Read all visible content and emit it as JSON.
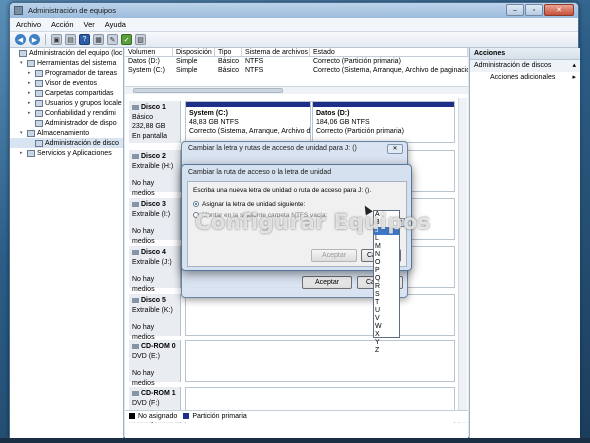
{
  "window": {
    "title": "Administración de equipos"
  },
  "menu": [
    "Archivo",
    "Acción",
    "Ver",
    "Ayuda"
  ],
  "tree": [
    {
      "label": "Administración del equipo (loc",
      "indent": 0,
      "expand": ""
    },
    {
      "label": "Herramientas del sistema",
      "indent": 1,
      "expand": "▾"
    },
    {
      "label": "Programador de tareas",
      "indent": 2,
      "expand": "▸"
    },
    {
      "label": "Visor de eventos",
      "indent": 2,
      "expand": "▸"
    },
    {
      "label": "Carpetas compartidas",
      "indent": 2,
      "expand": "▸"
    },
    {
      "label": "Usuarios y grupos locale",
      "indent": 2,
      "expand": "▸"
    },
    {
      "label": "Confiabilidad y rendimi",
      "indent": 2,
      "expand": "▸"
    },
    {
      "label": "Administrador de dispo",
      "indent": 2,
      "expand": ""
    },
    {
      "label": "Almacenamiento",
      "indent": 1,
      "expand": "▾"
    },
    {
      "label": "Administración de disco",
      "indent": 2,
      "expand": ""
    },
    {
      "label": "Servicios y Aplicaciones",
      "indent": 1,
      "expand": "▸"
    }
  ],
  "volume_columns": [
    "Volumen",
    "Disposición",
    "Tipo",
    "Sistema de archivos",
    "Estado"
  ],
  "volumes": [
    {
      "vol": "Datos (D:)",
      "disp": "Simple",
      "tipo": "Básico",
      "fs": "NTFS",
      "estado": "Correcto (Partición primaria)"
    },
    {
      "vol": "System (C:)",
      "disp": "Simple",
      "tipo": "Básico",
      "fs": "NTFS",
      "estado": "Correcto (Sistema, Arranque, Archivo de paginación"
    }
  ],
  "disks": [
    {
      "name": "Disco 1",
      "l1": "Básico",
      "l2": "232,88 GB",
      "l3": "En pantalla"
    },
    {
      "name": "Disco 2",
      "l1": "Extraíble (H:)",
      "l2": "",
      "l3": "No hay medios"
    },
    {
      "name": "Disco 3",
      "l1": "Extraíble (I:)",
      "l2": "",
      "l3": "No hay medios"
    },
    {
      "name": "Disco 4",
      "l1": "Extraíble (J:)",
      "l2": "",
      "l3": "No hay medios"
    },
    {
      "name": "Disco 5",
      "l1": "Extraíble (K:)",
      "l2": "",
      "l3": "No hay medios"
    },
    {
      "name": "CD-ROM 0",
      "l1": "DVD (E:)",
      "l2": "",
      "l3": "No hay medios"
    },
    {
      "name": "CD-ROM 1",
      "l1": "DVD (F:)",
      "l2": "",
      "l3": "No hay medios"
    }
  ],
  "partitions": {
    "c": {
      "title": "System (C:)",
      "size": "48,83 GB NTFS",
      "status": "Correcto (Sistema, Arranque, Archivo d"
    },
    "d": {
      "title": "Datos (D:)",
      "size": "184,06 GB NTFS",
      "status": "Correcto (Partición primaria)"
    }
  },
  "legend": {
    "unassigned": "No asignado",
    "primary": "Partición primaria",
    "unassigned_color": "#000000",
    "primary_color": "#1e2f8a"
  },
  "actions": {
    "header": "Acciones",
    "section": "Administración de discos",
    "item": "Acciones adicionales"
  },
  "dialog_back": {
    "title": "Cambiar la letra y rutas de acceso de unidad para J: ()",
    "ok": "Aceptar",
    "cancel": "Cancelar"
  },
  "dialog_front": {
    "title": "Cambiar la ruta de acceso o la letra de unidad",
    "prompt": "Escriba una nueva letra de unidad o ruta de acceso para J: ().",
    "opt1": "Asignar la letra de unidad siguiente:",
    "opt2": "Montar en la siguiente carpeta NTFS vacía:",
    "selected_letter": "J",
    "ok": "Aceptar",
    "cancel": "Cancelar"
  },
  "letters": [
    "A",
    "B",
    "J",
    "L",
    "M",
    "N",
    "O",
    "P",
    "Q",
    "R",
    "S",
    "T",
    "U",
    "V",
    "W",
    "X",
    "Y",
    "Z"
  ],
  "highlighted_letter": "J",
  "watermark": "Configurar Equipos"
}
